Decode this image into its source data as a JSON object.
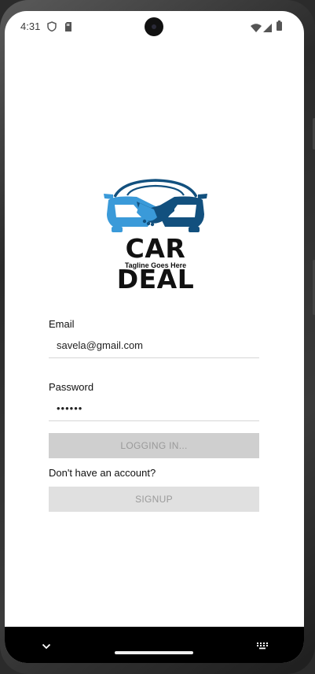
{
  "status_bar": {
    "time": "4:31",
    "left_icons": [
      "shield-icon",
      "sd-card-icon"
    ],
    "right_icons": [
      "wifi-icon",
      "signal-icon",
      "battery-icon"
    ]
  },
  "logo": {
    "title": "CAR DEAL",
    "tagline": "Tagline Goes Here",
    "colors": {
      "light_blue": "#3a9ad9",
      "dark_blue": "#12507e",
      "text": "#111111"
    }
  },
  "form": {
    "email_label": "Email",
    "email_value": "savela@gmail.com",
    "password_label": "Password",
    "password_value": "••••••",
    "login_button": "LOGGING IN...",
    "signup_prompt": "Don't have an account?",
    "signup_button": "SIGNUP"
  },
  "nav_bar": {
    "icons": [
      "chevron-down-icon",
      "keyboard-icon"
    ]
  }
}
